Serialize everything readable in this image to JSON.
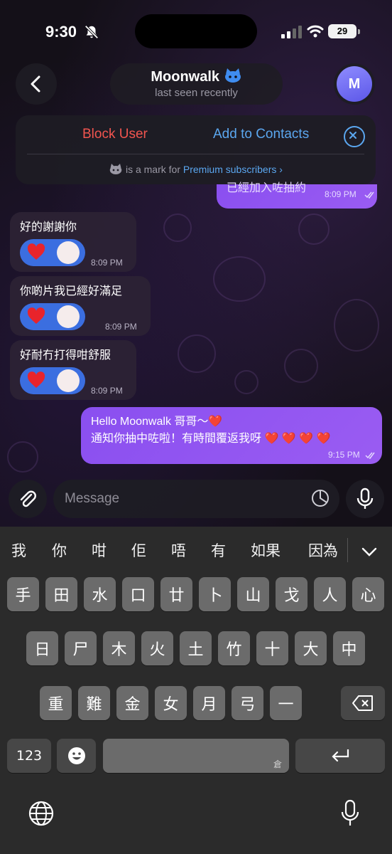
{
  "status_bar": {
    "time": "9:30",
    "battery": "29"
  },
  "header": {
    "name": "Moonwalk",
    "status": "last seen recently",
    "avatar_letter": "M"
  },
  "panel": {
    "block_label": "Block User",
    "add_label": "Add to Contacts",
    "premium_text": "is a mark for",
    "premium_link": "Premium subscribers"
  },
  "messages": [
    {
      "dir": "out",
      "text": "已經加入咗抽約",
      "time": "8:09 PM"
    },
    {
      "dir": "in",
      "text": "好的謝謝你",
      "time": "8:09 PM",
      "reaction": "heart"
    },
    {
      "dir": "in",
      "text": "你啲片我已經好滿足",
      "time": "8:09 PM",
      "reaction": "heart"
    },
    {
      "dir": "in",
      "text": "好耐冇打得咁舒服",
      "time": "8:09 PM",
      "reaction": "heart"
    },
    {
      "dir": "out",
      "line1": "Hello Moonwalk 哥哥～❤️",
      "line2": "通知你抽中咗啦！有時間覆返我呀 ❤️ ❤️ ❤️ ❤️",
      "time": "9:15 PM"
    }
  ],
  "input": {
    "placeholder": "Message"
  },
  "keyboard": {
    "candidates": [
      "我",
      "你",
      "咁",
      "佢",
      "唔",
      "有",
      "如果",
      "因為"
    ],
    "row1": [
      "手",
      "田",
      "水",
      "口",
      "廿",
      "卜",
      "山",
      "戈",
      "人",
      "心"
    ],
    "row2": [
      "日",
      "尸",
      "木",
      "火",
      "土",
      "竹",
      "十",
      "大",
      "中"
    ],
    "row3": [
      "重",
      "難",
      "金",
      "女",
      "月",
      "弓",
      "一"
    ],
    "numbers_key": "123",
    "space_hint": "倉"
  },
  "colors": {
    "accent": "#5ba7f0",
    "danger": "#f2554f",
    "outgoing": "#9a5cf2",
    "reaction": "#3b6ee0"
  }
}
